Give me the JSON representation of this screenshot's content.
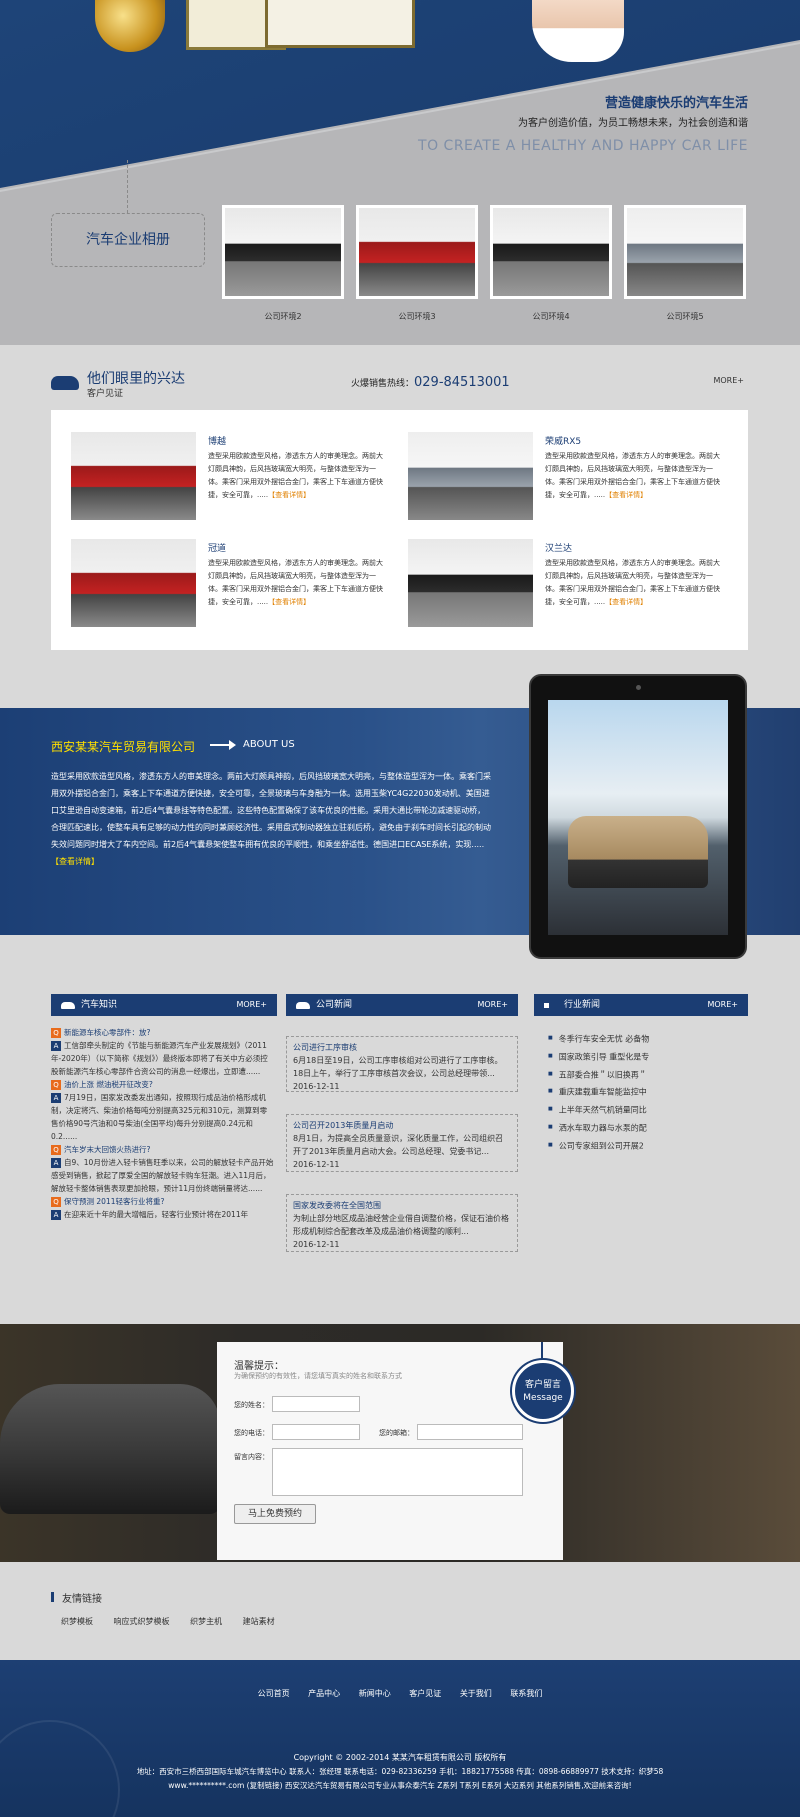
{
  "hero": {
    "slogan_cn": "营造健康快乐的汽车生活",
    "slogan_sub": "为客户创造价值，为员工畅想未来，为社会创造和谐",
    "slogan_en": "TO CREATE A HEALTHY AND HAPPY CAR LIFE",
    "album_label": "汽车企业相册",
    "album": [
      {
        "caption": "公司环境2"
      },
      {
        "caption": "公司环境3"
      },
      {
        "caption": "公司环境4"
      },
      {
        "caption": "公司环境5"
      }
    ]
  },
  "testimonials": {
    "title": "他们眼里的兴达",
    "subtitle": "客户见证",
    "hotline_label": "火爆销售热线：",
    "hotline": "029-84513001",
    "more": "MORE+",
    "items": [
      {
        "name": "博越",
        "desc": "造型采用欧款造型风格，渗透东方人的审美理念。两前大灯颇具神韵，后风挡玻璃宽大明亮，与整体造型浑为一体。乘客门采用双外摆铝合金门，乘客上下车通道方便快捷，安全可靠，.....",
        "link": "【查看详情】"
      },
      {
        "name": "荣威RX5",
        "desc": "造型采用欧款造型风格，渗透东方人的审美理念。两前大灯颇具神韵，后风挡玻璃宽大明亮，与整体造型浑为一体。乘客门采用双外摆铝合金门，乘客上下车通道方便快捷，安全可靠，.....",
        "link": "【查看详情】"
      },
      {
        "name": "冠道",
        "desc": "造型采用欧款造型风格，渗透东方人的审美理念。两前大灯颇具神韵，后风挡玻璃宽大明亮，与整体造型浑为一体。乘客门采用双外摆铝合金门，乘客上下车通道方便快捷，安全可靠，.....",
        "link": "【查看详情】"
      },
      {
        "name": "汉兰达",
        "desc": "造型采用欧款造型风格，渗透东方人的审美理念。两前大灯颇具神韵，后风挡玻璃宽大明亮，与整体造型浑为一体。乘客门采用双外摆铝合金门，乘客上下车通道方便快捷，安全可靠，.....",
        "link": "【查看详情】"
      }
    ]
  },
  "about": {
    "company": "西安某某汽车贸易有限公司",
    "en": "ABOUT US",
    "text": "造型采用欧款造型风格，渗透东方人的审美理念。两前大灯颇具神韵，后风挡玻璃宽大明亮，与整体造型浑为一体。乘客门采用双外摆铝合金门，乘客上下车通道方便快捷，安全可靠，全景玻璃与车身融为一体。选用玉柴YC4G22030发动机、美国进口艾里逊自动变速箱，前2后4气囊悬挂等特色配置。这些特色配置确保了该车优良的性能。采用大通比带轮边减速驱动桥，合理匹配速比，使整车具有足够的动力性的同时兼顾经济性。采用盘式制动器独立驻刹后桥，避免由于刹车时间长引起的制动失效问题同时增大了车内空间。前2后4气囊悬架使整车拥有优良的平顺性，和乘坐舒适性。德国进口ECASE系统，实现.....",
    "link": "【查看详情】"
  },
  "news": {
    "knowledge": {
      "title": "汽车知识",
      "more": "MORE+",
      "items": [
        {
          "q": "新能源车核心零部件：放?",
          "a": "工信部牵头制定的《节能与新能源汽车产业发展规划》（2011年-2020年）（以下简称《规划》）最终版本即将了有关中方必须控股新能源汽车核心零部件合资公司的消息一经爆出，立即遭......"
        },
        {
          "q": "油价上涨 燃油税开征改变?",
          "a": "7月19日，国家发改委发出通知，按照现行成品油价格形成机制，决定将汽、柴油价格每吨分别提高325元和310元，测算到零售价格90号汽油和0号柴油(全国平均)每升分别提高0.24元和0.2......"
        },
        {
          "q": "汽车岁末大回馈火热进行?",
          "a": "自9、10月份进入轻卡销售旺季以来，公司的解放轻卡产品开始感受到销售，掀起了厚爱全国的解放轻卡购车狂潮。进入11月后，解放轻卡整体销售表现更加抢眼，预计11月份终端销量将达......"
        },
        {
          "q": "保守预测 2011轻客行业将重?",
          "a": "在迎来近十年的最大增幅后，轻客行业预计将在2011年"
        }
      ]
    },
    "company": {
      "title": "公司新闻",
      "more": "MORE+",
      "items": [
        {
          "title": "公司进行工序审核",
          "text": "6月18日至19日，公司工序审核组对公司进行了工序审核。18日上午，举行了工序审核首次会议，公司总经理带领...",
          "date": "2016-12-11"
        },
        {
          "title": "公司召开2013年质量月启动",
          "text": "8月1日，为提高全员质量意识，深化质量工作，公司组织召开了2013年质量月启动大会。公司总经理、党委书记...",
          "date": "2016-12-11"
        },
        {
          "title": "国家发改委将在全国范围",
          "text": "为制止部分地区成品油经营企业借自调整价格，保证石油价格形成机制综合配套改革及成品油价格调整的顺利...",
          "date": "2016-12-11"
        }
      ]
    },
    "industry": {
      "title": "行业新闻",
      "more": "MORE+",
      "items": [
        "冬季行车安全无忧 必备物",
        "国家政策引导 重型化是专",
        "五部委合推＂以旧换再＂",
        "重庆建载重车智能监控中",
        "上半年天然气机销量同比",
        "洒水车取力器与水泵的配",
        "公司专家组到公司开展2"
      ]
    }
  },
  "message": {
    "tip": "温馨提示：",
    "tip2": "为确保预约的有效性，请您填写真实的姓名和联系方式",
    "name_label": "您的姓名：",
    "phone_label": "您的电话：",
    "email_label": "您的邮箱：",
    "content_label": "留言内容：",
    "submit": "马上免费预约",
    "badge_cn": "客户留言",
    "badge_en": "Message"
  },
  "links": {
    "title": "友情链接",
    "items": [
      "织梦模板",
      "响应式织梦模板",
      "织梦主机",
      "建站素材"
    ]
  },
  "footer": {
    "nav": [
      "公司首页",
      "产品中心",
      "新闻中心",
      "客户见证",
      "关于我们",
      "联系我们"
    ],
    "copyright": "Copyright © 2002-2014 某某汽车租赁有限公司 版权所有",
    "address": "地址：西安市三桥西部国际车城汽车博览中心   联系人：张经理   联系电话：029-82336259   手机：18821775588   传真：0898-66889977   技术支持：织梦58",
    "line3": "www.**********.com (复制链接)   西安汉达汽车贸易有限公司专业从事众泰汽车 Z系列 T系列 E系列 大迈系列 其他系列销售,欢迎前来咨询!"
  }
}
